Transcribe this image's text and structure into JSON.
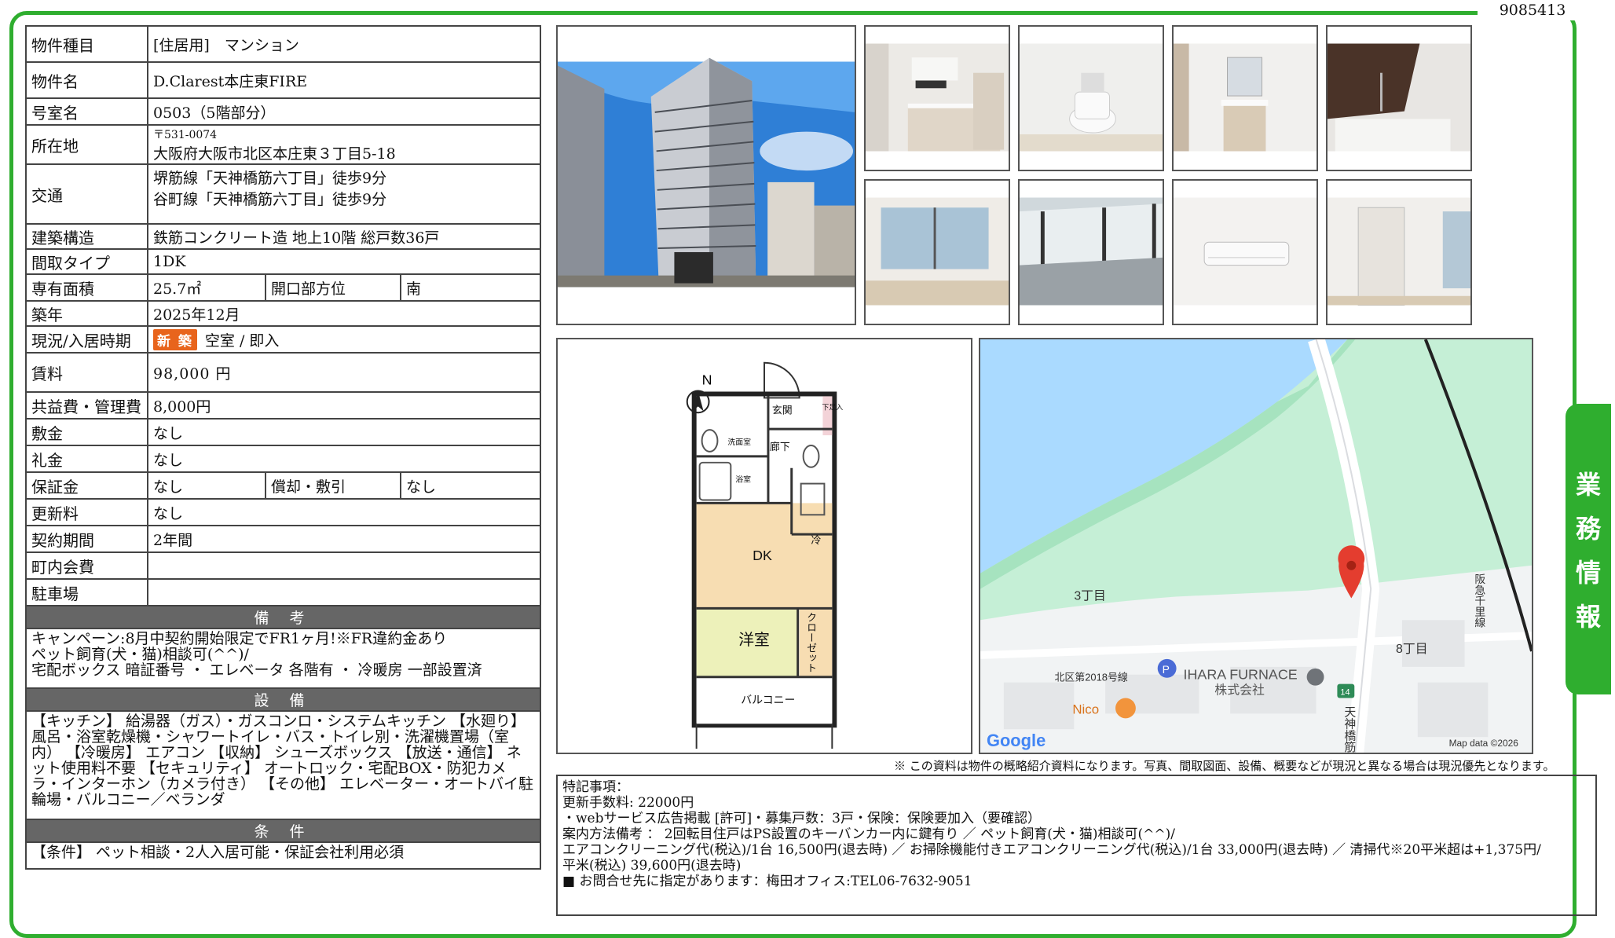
{
  "page_id": "9085413",
  "side_tab": [
    "業",
    "務",
    "情",
    "報"
  ],
  "spec": {
    "type": {
      "label": "物件種目",
      "value": "[住居用]　マンション"
    },
    "name": {
      "label": "物件名",
      "value": "D.Clarest本庄東FIRE"
    },
    "room": {
      "label": "号室名",
      "value": "0503（5階部分）"
    },
    "address": {
      "label": "所在地",
      "zip": "〒531-0074",
      "value": "大阪府大阪市北区本庄東３丁目5-18"
    },
    "transport": {
      "label": "交通",
      "line1": "堺筋線「天神橋筋六丁目」徒歩9分",
      "line2": "谷町線「天神橋筋六丁目」徒歩9分"
    },
    "structure": {
      "label": "建築構造",
      "value": "鉄筋コンクリート造 地上10階 総戸数36戸"
    },
    "layout": {
      "label": "間取タイプ",
      "value": "1DK"
    },
    "area": {
      "label": "専有面積",
      "value": "25.7㎡",
      "dir_label": "開口部方位",
      "dir_value": "南"
    },
    "built": {
      "label": "築年",
      "value": "2025年12月"
    },
    "status": {
      "label": "現況/入居時期",
      "badge": "新 築",
      "value": "空室 / 即入"
    },
    "rent": {
      "label": "賃料",
      "value": "98,000 円"
    },
    "fee": {
      "label": "共益費・管理費",
      "value": "8,000円"
    },
    "deposit": {
      "label": "敷金",
      "value": "なし"
    },
    "key_money": {
      "label": "礼金",
      "value": "なし"
    },
    "guarantee": {
      "label": "保証金",
      "value": "なし",
      "amort_label": "償却・敷引",
      "amort_value": "なし"
    },
    "renewal": {
      "label": "更新料",
      "value": "なし"
    },
    "contract": {
      "label": "契約期間",
      "value": "2年間"
    },
    "town_fee": {
      "label": "町内会費",
      "value": ""
    },
    "parking": {
      "label": "駐車場",
      "value": ""
    }
  },
  "bikou": {
    "title": "備 考",
    "lines": [
      "キャンペーン:8月中契約開始限定でFR1ヶ月!※FR違約金あり",
      "ペット飼育(犬・猫)相談可(^^)/",
      "宅配ボックス 暗証番号 ・ エレベータ 各階有 ・ 冷暖房 一部設置済"
    ]
  },
  "setsubi": {
    "title": "設 備",
    "text": "【キッチン】 給湯器（ガス）・ガスコンロ・システムキッチン 【水廻り】 風呂・浴室乾燥機・シャワートイレ・バス・トイレ別・洗濯機置場（室内） 【冷暖房】 エアコン 【収納】 シューズボックス 【放送・通信】 ネット使用料不要 【セキュリティ】 オートロック・宅配BOX・防犯カメラ・インターホン（カメラ付き） 【その他】 エレベーター・オートバイ駐輪場・バルコニー／ベランダ"
  },
  "jouken": {
    "title": "条 件",
    "text": "【条件】 ペット相談・2人入居可能・保証会社利用必須"
  },
  "floorplan": {
    "north": "N",
    "genkan": "玄関",
    "getabako": "下足入",
    "sentaku": "洗面室",
    "rouka": "廊下",
    "yokushitsu": "浴室",
    "rei": "冷",
    "dk": "DK",
    "youshitsu": "洋室",
    "closet": "クローゼット",
    "balcony": "バルコニー"
  },
  "map": {
    "chome3": "3丁目",
    "chome8": "8丁目",
    "road": "北区第2018号線",
    "company1": "IHARA FURNACE",
    "company2": "株式会社",
    "nico": "Nico",
    "route": "14",
    "street": "天神橋筋",
    "railway": "阪急千里線",
    "google": "Google",
    "credit": "Map data ©2026"
  },
  "notice": "※ この資料は物件の概略紹介資料になります。写真、間取図面、設備、概要などが現況と異なる場合は現況優先となります。",
  "remarks": {
    "l1": "特記事項：",
    "l2": "更新手数料: 22000円",
    "l3": "・webサービス広告掲載 [許可]・募集戸数：3戸・保険：保険要加入（要確認）",
    "l4": "案内方法備考 ： 2回転目住戸はPS設置のキーバンカー内に鍵有り ／ ペット飼育(犬・猫)相談可(^^)/",
    "l5": "エアコンクリーニング代(税込)/1台 16,500円(退去時) ／ お掃除機能付きエアコンクリーニング代(税込)/1台 33,000円(退去時) ／ 清掃代※20平米超は+1,375円/",
    "l6": "平米(税込) 39,600円(退去時)",
    "l7": "■ お問合せ先に指定があります：梅田オフィス:TEL06-7632-9051"
  }
}
